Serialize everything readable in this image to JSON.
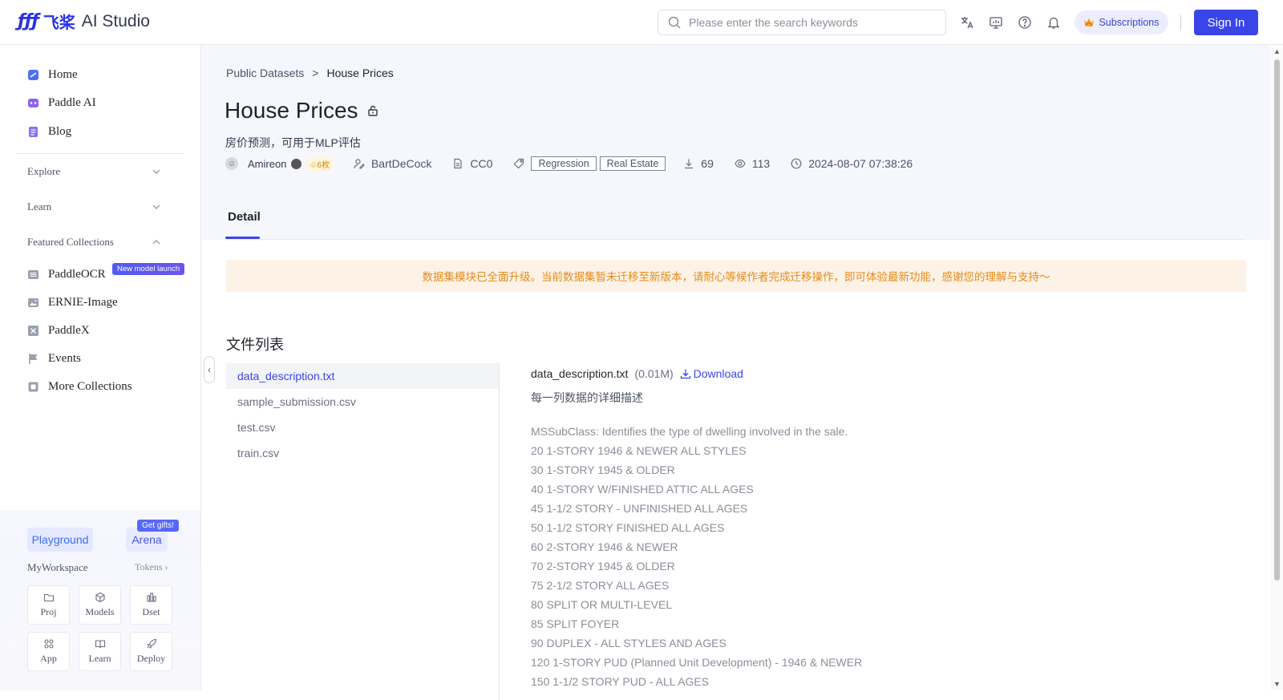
{
  "header": {
    "logo_mark": "ƒƒƒ",
    "logo_cn": "飞桨",
    "logo_text": "AI Studio",
    "search_placeholder": "Please enter the search keywords",
    "subscriptions": "Subscriptions",
    "sign_in": "Sign In",
    "icons": [
      "translate-icon",
      "monitor-icon",
      "help-icon",
      "bell-icon"
    ]
  },
  "sidebar": {
    "items": [
      {
        "label": "Home",
        "icon": "home-icon"
      },
      {
        "label": "Paddle AI",
        "icon": "paddle-ai-icon"
      },
      {
        "label": "Blog",
        "icon": "blog-icon"
      }
    ],
    "groups": [
      {
        "label": "Explore",
        "expanded": false
      },
      {
        "label": "Learn",
        "expanded": false
      },
      {
        "label": "Featured Collections",
        "expanded": true
      }
    ],
    "collections": [
      {
        "label": "PaddleOCR",
        "icon": "ocr-icon"
      },
      {
        "label": "ERNIE-Image",
        "icon": "image-icon"
      },
      {
        "label": "PaddleX",
        "icon": "paddlex-icon"
      },
      {
        "label": "Events",
        "icon": "flag-icon"
      },
      {
        "label": "More Collections",
        "icon": "collections-icon"
      }
    ],
    "new_badge": "New model launch",
    "workspace": {
      "playground": "Playground",
      "arena": "Arena",
      "gift_badge": "Get gifts!",
      "label": "MyWorkspace",
      "tokens": "Tokens",
      "tiles": [
        "Proj",
        "Models",
        "Dset",
        "App",
        "Learn",
        "Deploy"
      ]
    }
  },
  "main": {
    "breadcrumb": [
      "Public Datasets",
      "House Prices"
    ],
    "breadcrumb_sep": ">",
    "title": "House Prices",
    "subtitle": "房价预测，可用于MLP评估",
    "meta": {
      "user": "Amireon",
      "coins": "6枚",
      "author": "BartDeCock",
      "license": "CC0",
      "tags": [
        "Regression",
        "Real Estate"
      ],
      "downloads": "69",
      "views": "113",
      "date": "2024-08-07 07:38:26"
    },
    "tab": "Detail",
    "notice": "数据集模块已全面升级。当前数据集暂未迁移至新版本，请耐心等候作者完成迁移操作，即可体验最新功能，感谢您的理解与支持～",
    "file_list_title": "文件列表",
    "files": [
      "data_description.txt",
      "sample_submission.csv",
      "test.csv",
      "train.csv"
    ],
    "active_file": 0,
    "preview": {
      "filename": "data_description.txt",
      "size": "(0.01M)",
      "download": "Download",
      "description": "每一列数据的详细描述",
      "lines": [
        "MSSubClass: Identifies the type of dwelling involved in the sale.",
        "20 1-STORY 1946 & NEWER ALL STYLES",
        "30 1-STORY 1945 & OLDER",
        "40 1-STORY W/FINISHED ATTIC ALL AGES",
        "45 1-1/2 STORY - UNFINISHED ALL AGES",
        "50 1-1/2 STORY FINISHED ALL AGES",
        "60 2-STORY 1946 & NEWER",
        "70 2-STORY 1945 & OLDER",
        "75 2-1/2 STORY ALL AGES",
        "80 SPLIT OR MULTI-LEVEL",
        "85 SPLIT FOYER",
        "90 DUPLEX - ALL STYLES AND AGES",
        "120 1-STORY PUD (Planned Unit Development) - 1946 & NEWER",
        "150 1-1/2 STORY PUD - ALL AGES"
      ]
    }
  },
  "colors": {
    "brand": "#2932e1",
    "primary": "#3a45e8",
    "notice_bg": "#fdf2e6",
    "notice_text": "#e88b1a"
  }
}
